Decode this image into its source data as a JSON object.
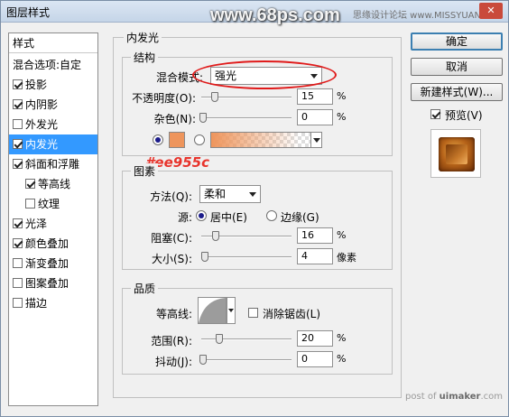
{
  "window": {
    "title": "图层样式",
    "close_label": "✕"
  },
  "watermarks": {
    "site": "www.68ps.com",
    "forum": "思缘设计论坛 www.MISSYUAN.com",
    "footer_prefix": "post of ",
    "footer_site": "uimaker",
    "footer_suffix": ".com"
  },
  "sidebar": {
    "header": "样式",
    "blend_options": "混合选项:自定",
    "items": [
      {
        "label": "投影",
        "checked": true
      },
      {
        "label": "内阴影",
        "checked": true
      },
      {
        "label": "外发光",
        "checked": false
      },
      {
        "label": "内发光",
        "checked": true
      },
      {
        "label": "斜面和浮雕",
        "checked": true
      },
      {
        "label": "等高线",
        "checked": true
      },
      {
        "label": "纹理",
        "checked": false
      },
      {
        "label": "光泽",
        "checked": true
      },
      {
        "label": "颜色叠加",
        "checked": true
      },
      {
        "label": "渐变叠加",
        "checked": false
      },
      {
        "label": "图案叠加",
        "checked": false
      },
      {
        "label": "描边",
        "checked": false
      }
    ]
  },
  "inner_glow": {
    "title": "内发光",
    "structure": {
      "title": "结构",
      "blend_mode_label": "混合模式:",
      "blend_mode_value": "强光",
      "opacity_label": "不透明度(O):",
      "opacity_value": "15",
      "opacity_unit": "%",
      "opacity_level": 0.15,
      "noise_label": "杂色(N):",
      "noise_value": "0",
      "noise_unit": "%",
      "noise_level": 0
    },
    "color_annotation": "#ee955c",
    "glow_color": "#ee955c",
    "elements": {
      "title": "图素",
      "method_label": "方法(Q):",
      "method_value": "柔和",
      "source_label": "源:",
      "source_center": "居中(E)",
      "source_edge": "边缘(G)",
      "choke_label": "阻塞(C):",
      "choke_value": "16",
      "choke_unit": "%",
      "choke_level": 0.16,
      "size_label": "大小(S):",
      "size_value": "4",
      "size_unit": "像素",
      "size_level": 0.016
    },
    "quality": {
      "title": "品质",
      "contour_label": "等高线:",
      "antialias_label": "消除锯齿(L)",
      "range_label": "范围(R):",
      "range_value": "20",
      "range_unit": "%",
      "range_level": 0.2,
      "jitter_label": "抖动(J):",
      "jitter_value": "0",
      "jitter_unit": "%",
      "jitter_level": 0
    }
  },
  "buttons": {
    "ok": "确定",
    "cancel": "取消",
    "new_style": "新建样式(W)...",
    "preview": "预览(V)"
  }
}
